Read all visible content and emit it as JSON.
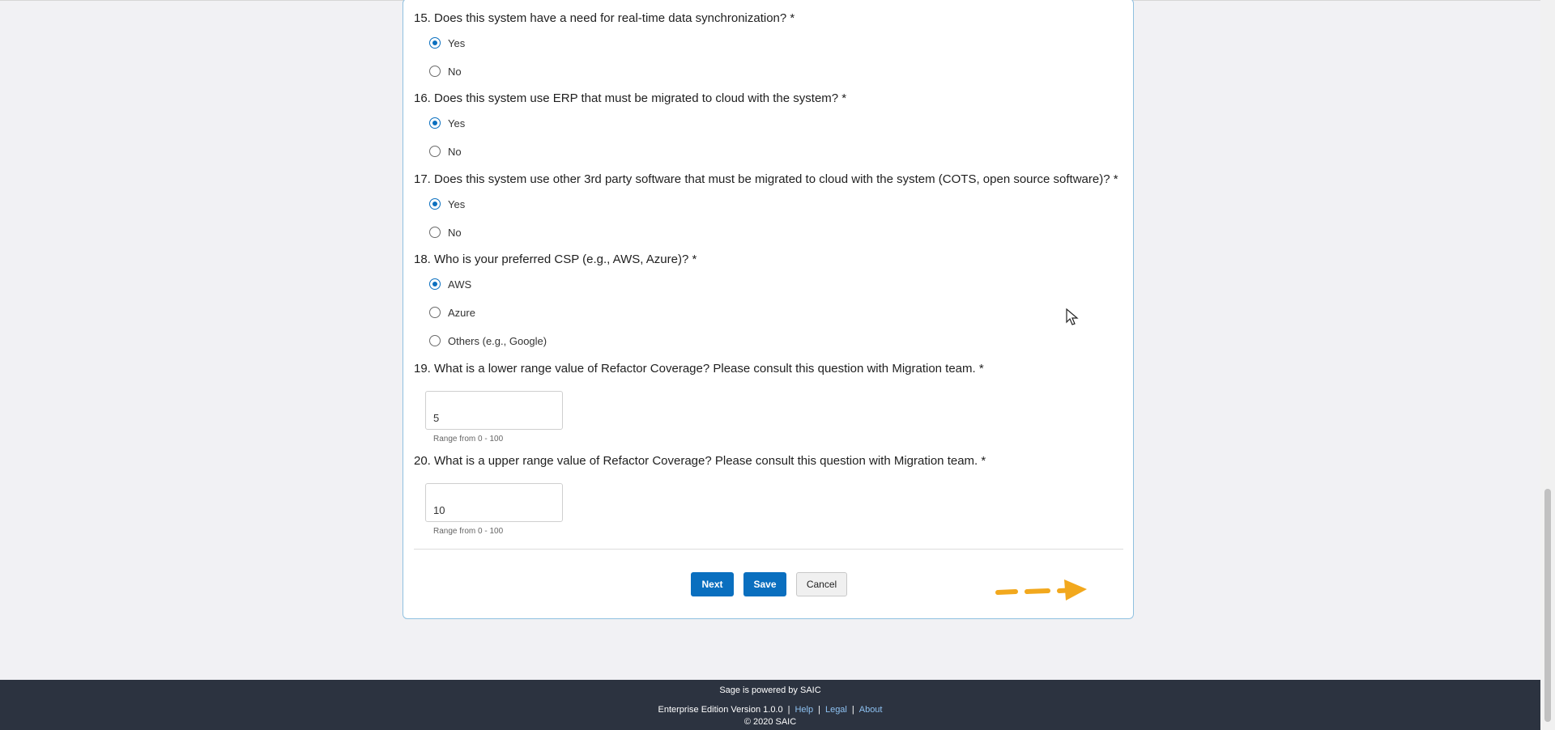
{
  "questions": [
    {
      "label": "15. Does this system have a need for real-time data synchronization? *",
      "options": [
        "Yes",
        "No"
      ],
      "selected": "Yes"
    },
    {
      "label": "16. Does this system use ERP that must be migrated to cloud with the system? *",
      "options": [
        "Yes",
        "No"
      ],
      "selected": "Yes"
    },
    {
      "label": "17. Does this system use other 3rd party software that must be migrated to cloud with the system (COTS, open source software)? *",
      "options": [
        "Yes",
        "No"
      ],
      "selected": "Yes"
    },
    {
      "label": "18. Who is your preferred CSP (e.g., AWS, Azure)? *",
      "options": [
        "AWS",
        "Azure",
        "Others (e.g., Google)"
      ],
      "selected": "AWS"
    },
    {
      "label": "19. What is a lower range value of Refactor Coverage? Please consult this question with Migration team. *",
      "value": "5",
      "hint": "Range from 0 - 100"
    },
    {
      "label": "20. What is a upper range value of Refactor Coverage? Please consult this question with Migration team. *",
      "value": "10",
      "hint": "Range from 0 - 100"
    }
  ],
  "buttons": {
    "next": "Next",
    "save": "Save",
    "cancel": "Cancel"
  },
  "footer": {
    "powered_by": "Sage is powered by SAIC",
    "edition": "Enterprise Edition Version 1.0.0",
    "separator": "|",
    "help": "Help",
    "legal": "Legal",
    "about": "About",
    "copyright": "© 2020 SAIC"
  },
  "colors": {
    "primary": "#0a6fbf",
    "footer_bg": "#2c3340",
    "arrow": "#f2a81d"
  }
}
